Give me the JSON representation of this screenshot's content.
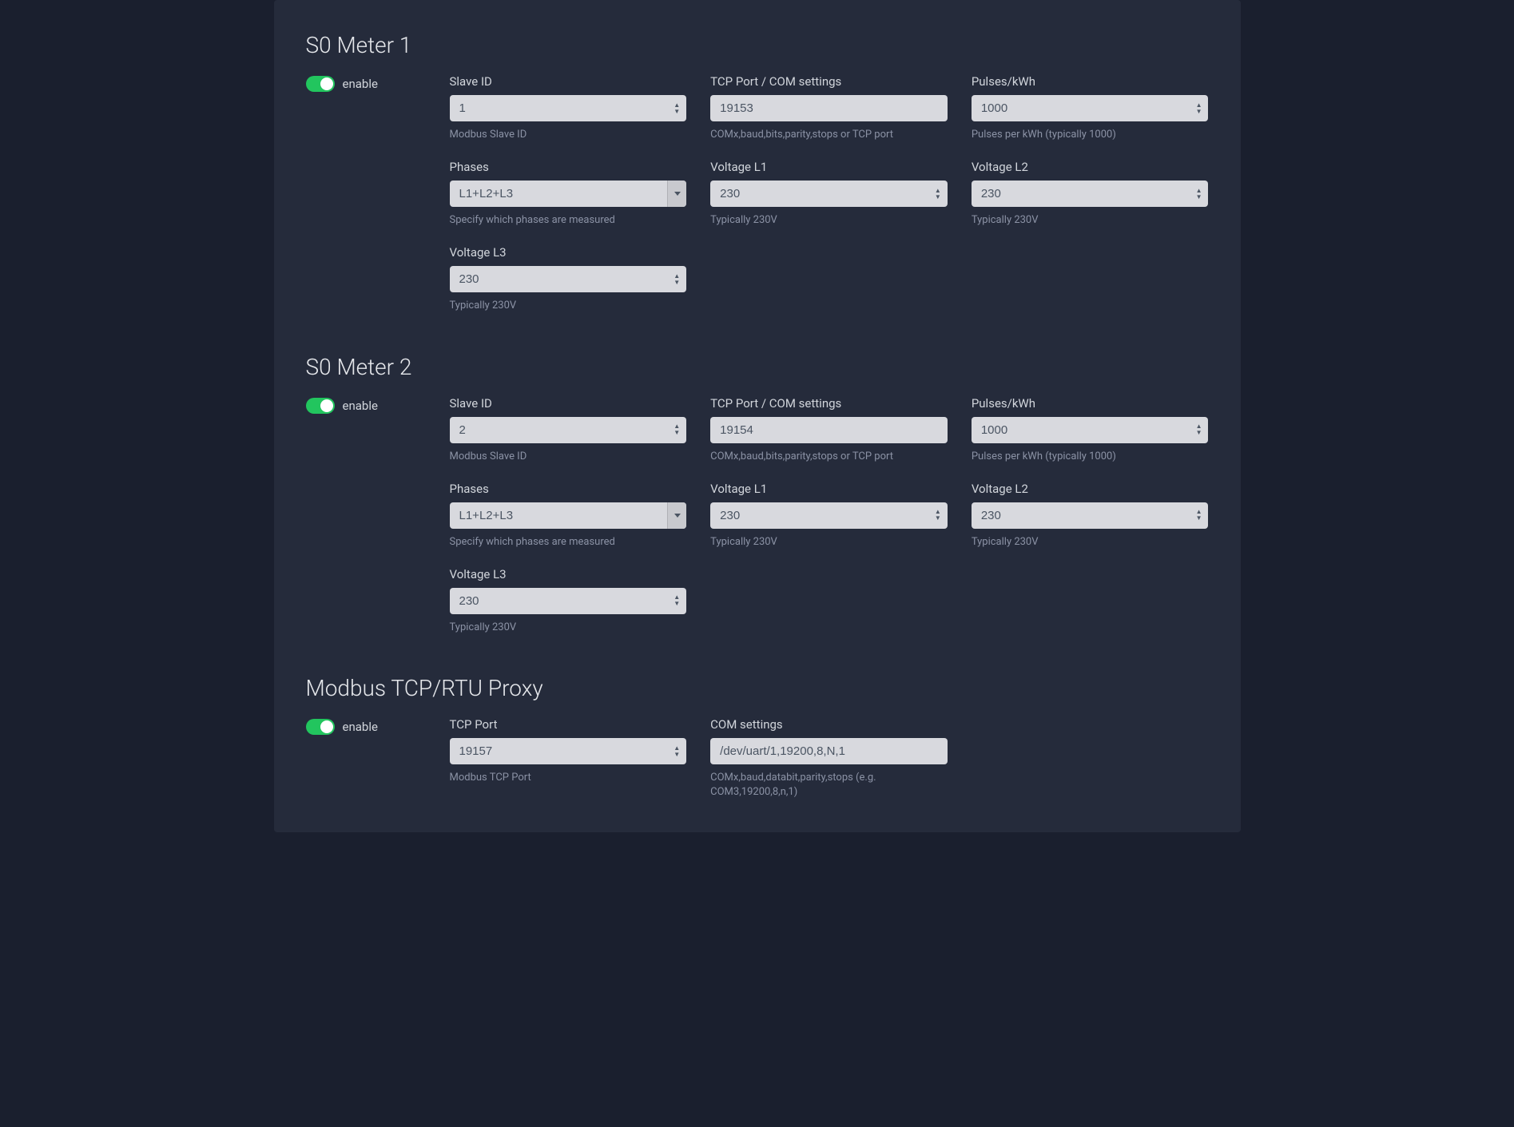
{
  "meter1": {
    "title": "S0 Meter 1",
    "enable_label": "enable",
    "enabled": true,
    "slave_id": {
      "label": "Slave ID",
      "value": "1",
      "hint": "Modbus Slave ID"
    },
    "tcp_port": {
      "label": "TCP Port / COM settings",
      "value": "19153",
      "hint": "COMx,baud,bits,parity,stops or TCP port"
    },
    "pulses": {
      "label": "Pulses/kWh",
      "value": "1000",
      "hint": "Pulses per kWh (typically 1000)"
    },
    "phases": {
      "label": "Phases",
      "value": "L1+L2+L3",
      "hint": "Specify which phases are measured"
    },
    "voltage_l1": {
      "label": "Voltage L1",
      "value": "230",
      "hint": "Typically 230V"
    },
    "voltage_l2": {
      "label": "Voltage L2",
      "value": "230",
      "hint": "Typically 230V"
    },
    "voltage_l3": {
      "label": "Voltage L3",
      "value": "230",
      "hint": "Typically 230V"
    }
  },
  "meter2": {
    "title": "S0 Meter 2",
    "enable_label": "enable",
    "enabled": true,
    "slave_id": {
      "label": "Slave ID",
      "value": "2",
      "hint": "Modbus Slave ID"
    },
    "tcp_port": {
      "label": "TCP Port / COM settings",
      "value": "19154",
      "hint": "COMx,baud,bits,parity,stops or TCP port"
    },
    "pulses": {
      "label": "Pulses/kWh",
      "value": "1000",
      "hint": "Pulses per kWh (typically 1000)"
    },
    "phases": {
      "label": "Phases",
      "value": "L1+L2+L3",
      "hint": "Specify which phases are measured"
    },
    "voltage_l1": {
      "label": "Voltage L1",
      "value": "230",
      "hint": "Typically 230V"
    },
    "voltage_l2": {
      "label": "Voltage L2",
      "value": "230",
      "hint": "Typically 230V"
    },
    "voltage_l3": {
      "label": "Voltage L3",
      "value": "230",
      "hint": "Typically 230V"
    }
  },
  "proxy": {
    "title": "Modbus TCP/RTU Proxy",
    "enable_label": "enable",
    "enabled": true,
    "tcp_port": {
      "label": "TCP Port",
      "value": "19157",
      "hint": "Modbus TCP Port"
    },
    "com_settings": {
      "label": "COM settings",
      "value": "/dev/uart/1,19200,8,N,1",
      "hint": "COMx,baud,databit,parity,stops (e.g. COM3,19200,8,n,1)"
    }
  }
}
